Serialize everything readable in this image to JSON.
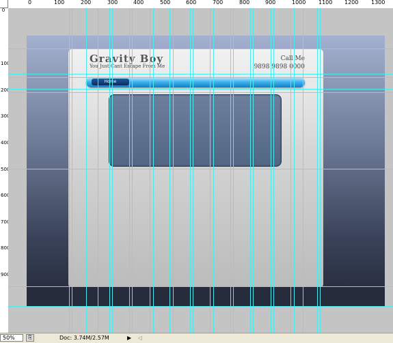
{
  "ruler": {
    "h_labels": [
      "0",
      "100",
      "200",
      "300",
      "400",
      "500",
      "600",
      "700",
      "800",
      "900",
      "1000",
      "1100",
      "1200",
      "1300"
    ],
    "v_labels": [
      "0",
      "100",
      "200",
      "300",
      "400",
      "500",
      "600",
      "700",
      "800",
      "900"
    ]
  },
  "document": {
    "site_title": "Gravity Boy",
    "site_tagline": "You Just Cant Escape From Me",
    "call_label": "Call Me",
    "phone": "9898 9898 0000",
    "nav_home": "Home"
  },
  "status": {
    "zoom": "50%",
    "doc_info": "Doc: 3.74M/2.57M",
    "arrow": "▶",
    "scroll_left": "◁"
  }
}
